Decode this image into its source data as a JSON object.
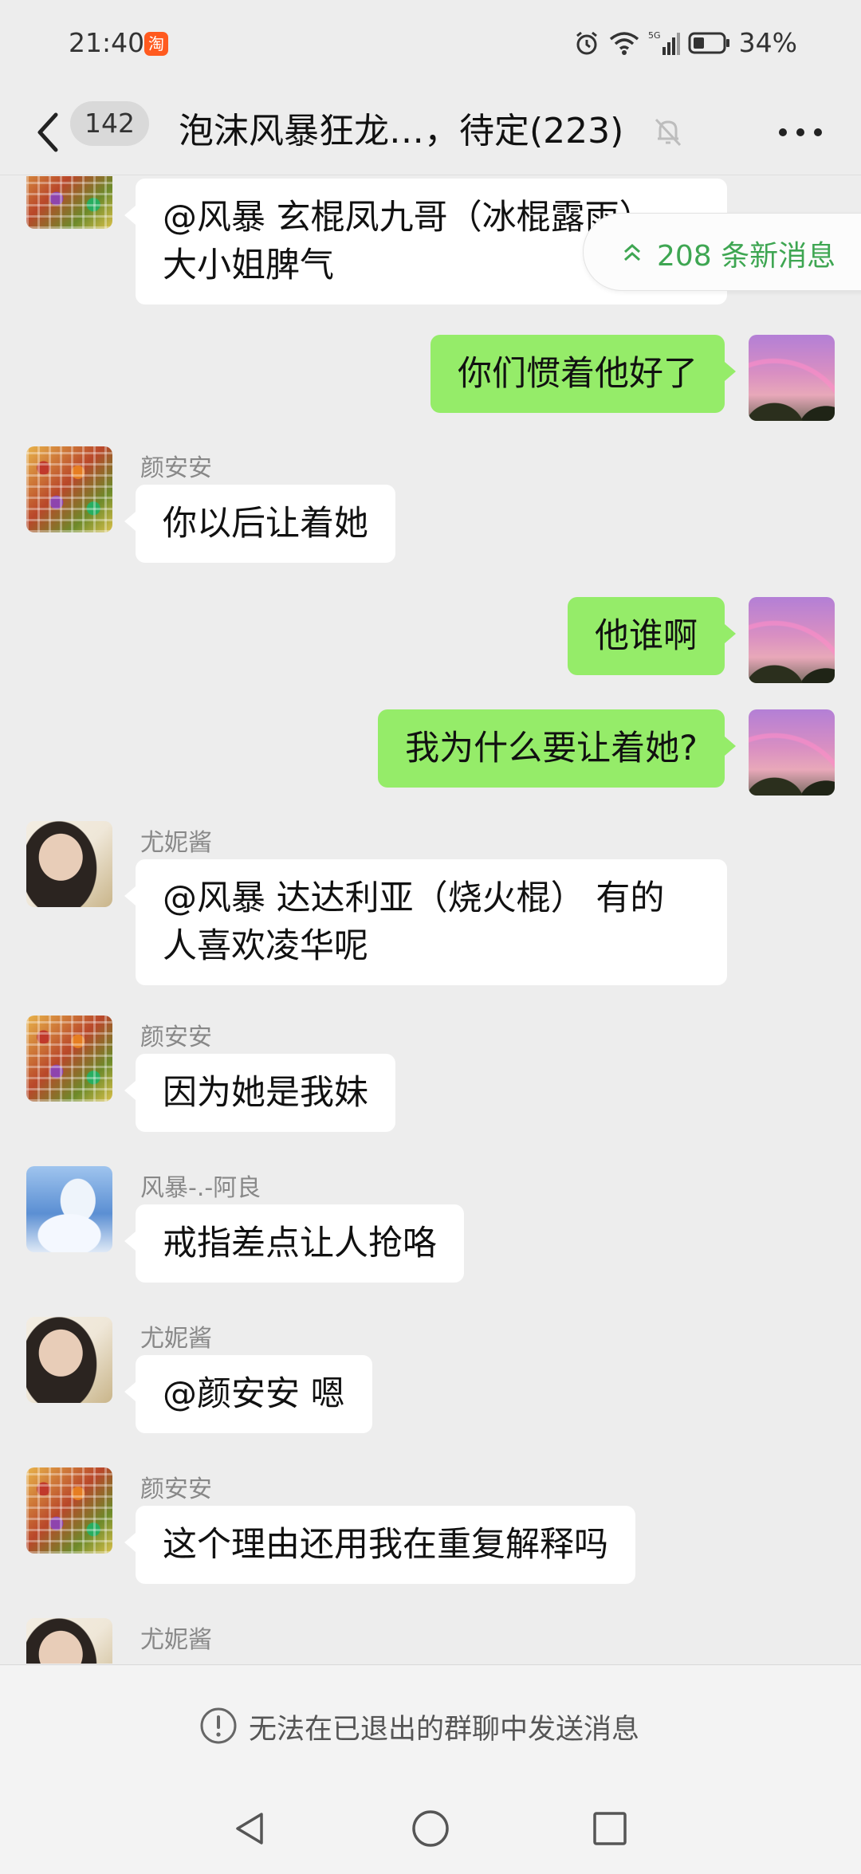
{
  "status_bar": {
    "time": "21:40",
    "taobao_badge": "淘",
    "network": "5G",
    "battery": "34%"
  },
  "header": {
    "unread_count": "142",
    "title": "泡沫风暴狂龙…，待定(223)"
  },
  "new_messages": {
    "label": "208 条新消息"
  },
  "messages": [
    {
      "side": "in",
      "avatar": "food",
      "sender": "",
      "text_lines": [
        "@风暴  玄棍凤九哥（冰棍露雨）",
        "大小姐脾气"
      ]
    },
    {
      "side": "out",
      "avatar": "rainbow",
      "text_lines": [
        "你们惯着他好了"
      ]
    },
    {
      "side": "in",
      "avatar": "food",
      "sender": "颜安安",
      "text_lines": [
        "你以后让着她"
      ]
    },
    {
      "side": "out",
      "avatar": "rainbow",
      "text_lines": [
        "他谁啊"
      ]
    },
    {
      "side": "out",
      "avatar": "rainbow",
      "text_lines": [
        "我为什么要让着她?"
      ]
    },
    {
      "side": "in",
      "avatar": "girl",
      "sender": "尤妮酱",
      "text_lines": [
        "@风暴 达达利亚（烧火棍）  有的",
        "人喜欢凌华呢"
      ]
    },
    {
      "side": "in",
      "avatar": "food",
      "sender": "颜安安",
      "text_lines": [
        "因为她是我妹"
      ]
    },
    {
      "side": "in",
      "avatar": "winter",
      "sender": "风暴-.-阿良",
      "text_lines": [
        "戒指差点让人抢咯"
      ]
    },
    {
      "side": "in",
      "avatar": "girl",
      "sender": "尤妮酱",
      "text_lines": [
        "@颜安安  嗯"
      ]
    },
    {
      "side": "in",
      "avatar": "food",
      "sender": "颜安安",
      "text_lines": [
        "这个理由还用我在重复解释吗"
      ]
    },
    {
      "side": "in",
      "avatar": "girl",
      "sender": "尤妮酱",
      "text_lines": []
    }
  ],
  "notice": {
    "text": "无法在已退出的群聊中发送消息"
  }
}
